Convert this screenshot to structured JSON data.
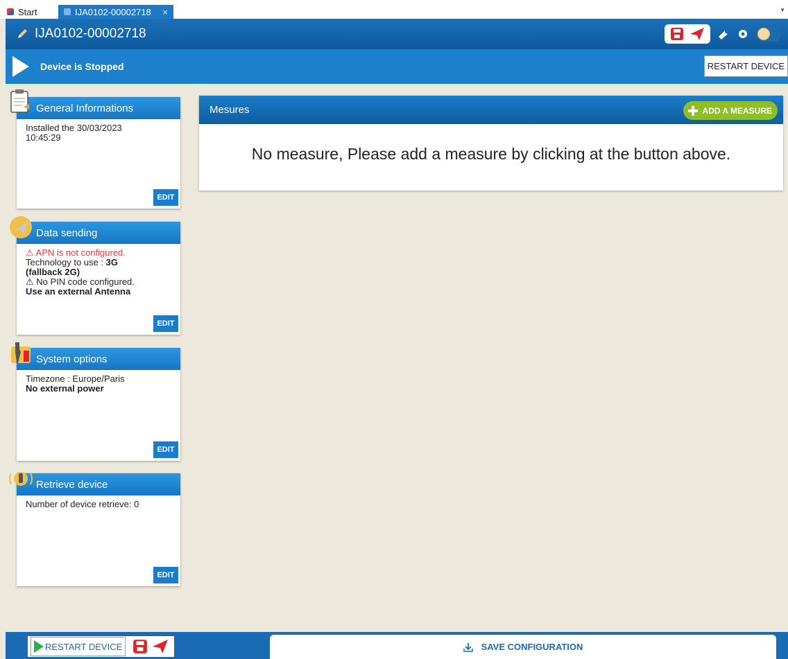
{
  "tabs": [
    {
      "label": "Start"
    },
    {
      "label": "IJA0102-00002718",
      "close": "×"
    }
  ],
  "header": {
    "title": "IJA0102-00002718"
  },
  "status": {
    "text": "Device is Stopped",
    "restart_label": "RESTART DEVICE"
  },
  "cards": {
    "general": {
      "title": "General Informations",
      "line1": "Installed the 30/03/2023",
      "line2": "10:45:29",
      "edit": "EDIT"
    },
    "data_sending": {
      "title": "Data sending",
      "apn_warning": "⚠ APN is not configured.",
      "tech_prefix": "Technology to use : ",
      "tech_value": "3G",
      "fallback": "(fallback 2G)",
      "pin_warning": "⚠ No PIN code configured.",
      "antenna": "Use an external Antenna",
      "edit": "EDIT"
    },
    "system": {
      "title": "System options",
      "timezone": "Timezone : Europe/Paris",
      "power": "No external power",
      "edit": "EDIT"
    },
    "retrieve": {
      "title": "Retrieve device",
      "count": "Number of device retrieve: 0",
      "edit": "EDIT"
    }
  },
  "mesures": {
    "title": "Mesures",
    "add_label": "ADD A MEASURE",
    "empty_message": "No measure, Please add a measure by clicking at the button above."
  },
  "footer": {
    "restart_label": "RESTART DEVICE",
    "save_label": "SAVE CONFIGURATION"
  },
  "colors": {
    "brand_blue": "#1a6bb3",
    "accent_red": "#e0242b",
    "add_green": "#8ebf2b",
    "warning_red": "#e53935"
  }
}
